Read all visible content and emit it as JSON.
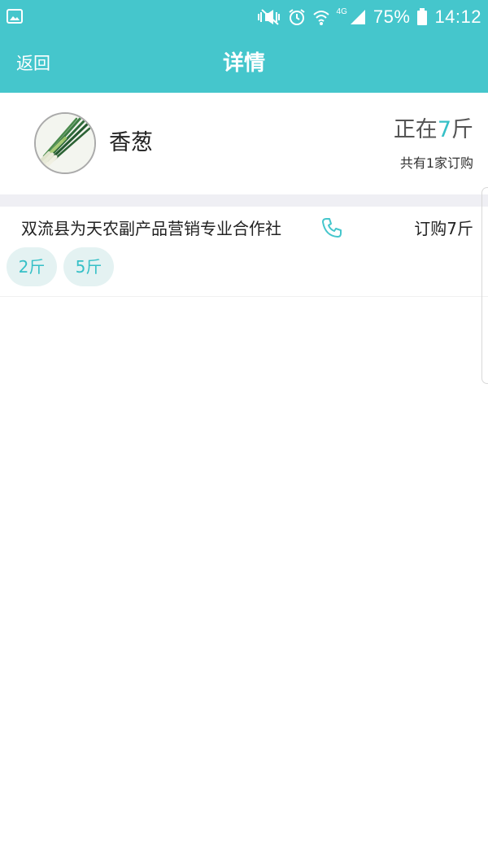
{
  "status_bar": {
    "battery": "75%",
    "time": "14:12",
    "network": "4G",
    "icons": [
      "gallery-icon",
      "mute-vibrate-icon",
      "alarm-icon",
      "wifi-icon",
      "signal-icon",
      "battery-icon"
    ]
  },
  "app_bar": {
    "back_label": "返回",
    "title": "详情"
  },
  "product": {
    "name": "香葱",
    "status_prefix": "正在",
    "status_amount": "7",
    "status_unit": "斤",
    "order_count": "共有1家订购"
  },
  "vendors": [
    {
      "name": "双流县为天农副产品营销专业合作社",
      "order": "订购7斤",
      "amounts": [
        "2斤",
        "5斤"
      ]
    }
  ],
  "colors": {
    "accent": "#45c6cc",
    "highlight": "#36c0c7",
    "tag_background": "#e4f2f2",
    "divider": "#efeff4"
  }
}
